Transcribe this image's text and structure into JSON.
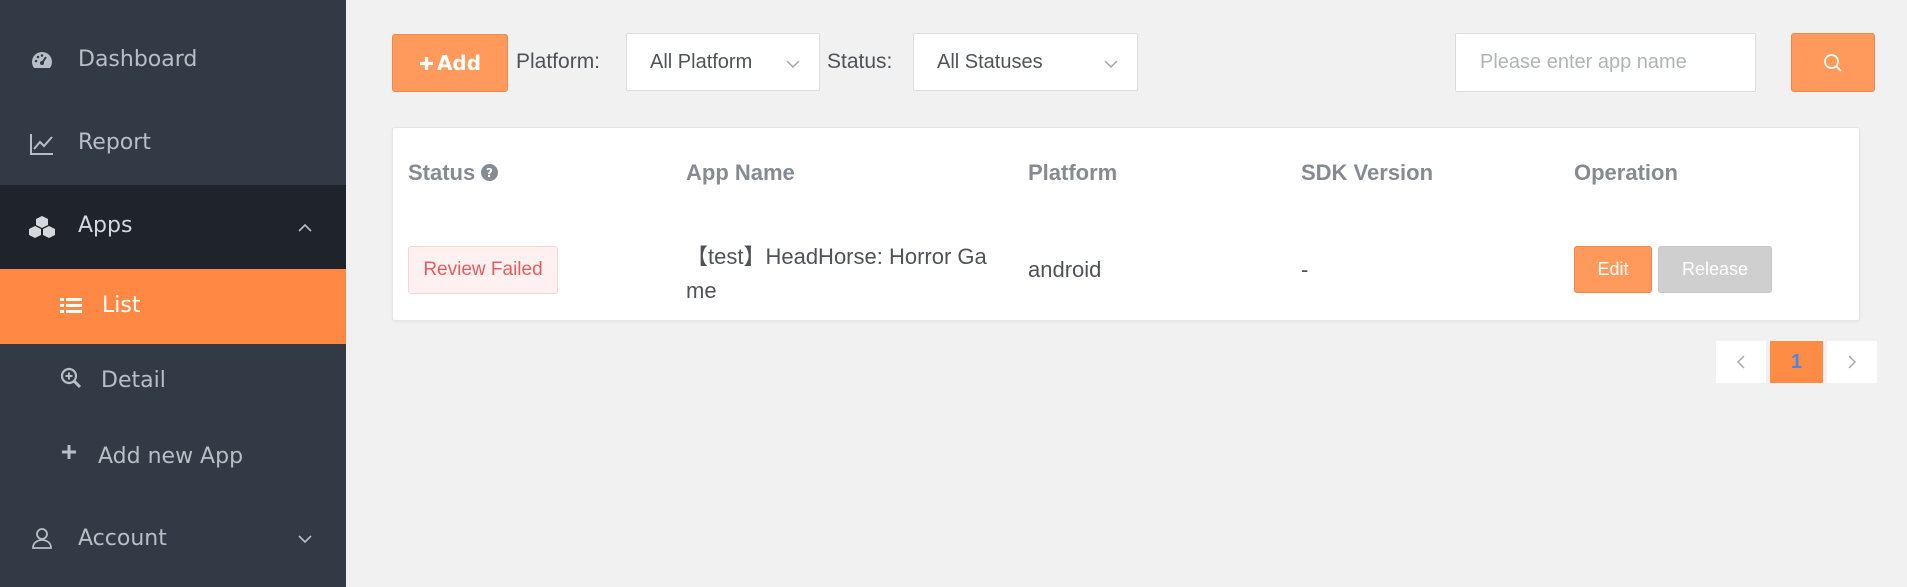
{
  "sidebar": {
    "items": [
      {
        "label": "Dashboard",
        "icon": "dashboard-icon"
      },
      {
        "label": "Report",
        "icon": "line-chart-icon"
      },
      {
        "label": "Apps",
        "icon": "cubes-icon",
        "expanded": true
      },
      {
        "label": "List",
        "icon": "list-icon",
        "active": true
      },
      {
        "label": "Detail",
        "icon": "search-plus-icon"
      },
      {
        "label": "Add new App",
        "icon": "plus-icon"
      },
      {
        "label": "Account",
        "icon": "user-icon",
        "expanded": false
      }
    ]
  },
  "toolbar": {
    "add_label": "Add",
    "platform_label": "Platform:",
    "platform_value": "All Platform",
    "status_label": "Status:",
    "status_value": "All Statuses",
    "search_placeholder": "Please enter app name"
  },
  "table": {
    "columns": [
      "Status",
      "App Name",
      "Platform",
      "SDK Version",
      "Operation"
    ],
    "rows": [
      {
        "status": "Review Failed",
        "app_name": "【test】HeadHorse: Horror Game",
        "platform": "android",
        "sdk_version": "-",
        "edit_label": "Edit",
        "release_label": "Release"
      }
    ]
  },
  "pagination": {
    "current_page": "1"
  },
  "colors": {
    "accent": "#ff8944",
    "sidebar_bg": "#323a46",
    "sidebar_active_group": "#1f242c",
    "status_failed": "#ea5c5c",
    "page_bg": "#f1f1f1"
  }
}
